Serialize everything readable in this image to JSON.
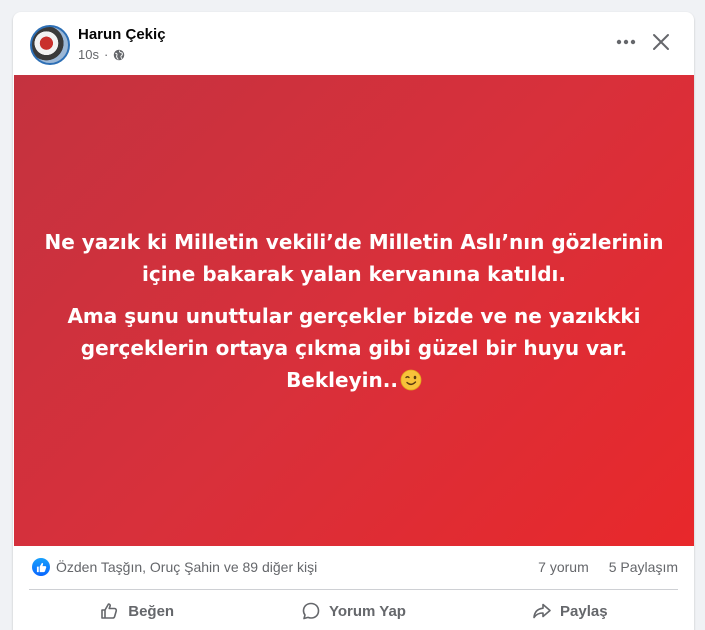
{
  "post": {
    "author": "Harun Çekiç",
    "time": "10s",
    "text_lines": [
      "Ne yazık ki Milletin vekili’de Milletin Aslı’nın gözlerinin içine bakarak yalan kervanına katıldı.",
      "Ama şunu unuttular gerçekler bizde ve ne yazıkkki gerçeklerin ortaya çıkma gibi güzel bir huyu var. Bekleyin.."
    ],
    "emoji": "winking-face",
    "background_colors": [
      "#c4323f",
      "#e8282b"
    ]
  },
  "header": {
    "more_icon": "more-horizontal-icon",
    "close_icon": "close-icon",
    "privacy_icon": "globe-icon"
  },
  "reactions": {
    "summary": "Özden Taşğın, Oruç Şahin ve 89 diğer kişi",
    "comments": "7 yorum",
    "shares": "5 Paylaşım"
  },
  "actions": {
    "like": "Beğen",
    "comment": "Yorum Yap",
    "share": "Paylaş"
  },
  "colors": {
    "accent": "#0866ff",
    "secondary_text": "#65676b"
  }
}
